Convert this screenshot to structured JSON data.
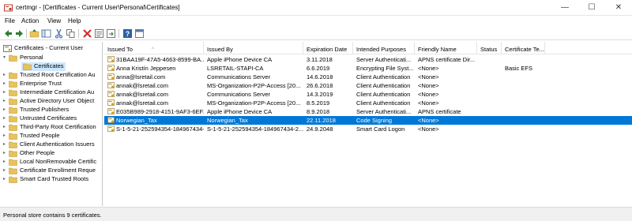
{
  "window": {
    "title": "certmgr - [Certificates - Current User\\Personal\\Certificates]",
    "minimize_glyph": "—",
    "maximize_glyph": "☐",
    "close_glyph": "✕"
  },
  "menu": [
    "File",
    "Action",
    "View",
    "Help"
  ],
  "toolbar": {
    "icons": [
      "back-icon",
      "forward-icon",
      "up-folder-icon",
      "show-hide-tree-icon",
      "cut-icon",
      "copy-icon",
      "delete-icon",
      "properties-icon",
      "export-icon",
      "help-icon",
      "console-icon"
    ]
  },
  "tree": {
    "root": "Certificates - Current User",
    "personal": "Personal",
    "certificates": "Certificates",
    "stores": [
      "Trusted Root Certification Au",
      "Enterprise Trust",
      "Intermediate Certification Au",
      "Active Directory User Object",
      "Trusted Publishers",
      "Untrusted Certificates",
      "Third-Party Root Certification",
      "Trusted People",
      "Client Authentication Issuers",
      "Other People",
      "Local NonRemovable Certific",
      "Certificate Enrollment Reque",
      "Smart Card Trusted Roots"
    ]
  },
  "columns": [
    "Issued To",
    "Issued By",
    "Expiration Date",
    "Intended Purposes",
    "Friendly Name",
    "Status",
    "Certificate Te..."
  ],
  "rows": [
    {
      "issued_to": "31BAA19F-47A5-4663-8599-BA...",
      "issued_by": "Apple iPhone Device CA",
      "expiration": "3.11.2018",
      "purposes": "Server Authenticati...",
      "friendly": "APNS certificate Dir...",
      "status": "",
      "template": ""
    },
    {
      "issued_to": "Anna Kristín Jeppesen",
      "issued_by": "LSRETAIL-STAPI-CA",
      "expiration": "6.6.2019",
      "purposes": "Encrypting File Syst...",
      "friendly": "<None>",
      "status": "",
      "template": "Basic EFS"
    },
    {
      "issued_to": "anna@lsretail.com",
      "issued_by": "Communications Server",
      "expiration": "14.6.2018",
      "purposes": "Client Authentication",
      "friendly": "<None>",
      "status": "",
      "template": ""
    },
    {
      "issued_to": "annak@lsretail.com",
      "issued_by": "MS-Organization-P2P-Access [20...",
      "expiration": "26.6.2018",
      "purposes": "Client Authentication",
      "friendly": "<None>",
      "status": "",
      "template": ""
    },
    {
      "issued_to": "annak@lsretail.com",
      "issued_by": "Communications Server",
      "expiration": "14.3.2019",
      "purposes": "Client Authentication",
      "friendly": "<None>",
      "status": "",
      "template": ""
    },
    {
      "issued_to": "annak@lsretail.com",
      "issued_by": "MS-Organization-P2P-Access [20...",
      "expiration": "8.5.2019",
      "purposes": "Client Authentication",
      "friendly": "<None>",
      "status": "",
      "template": ""
    },
    {
      "issued_to": "E035B989-2918-4151-9AF3-6EF2...",
      "issued_by": "Apple iPhone Device CA",
      "expiration": "8.9.2018",
      "purposes": "Server Authenticati...",
      "friendly": "APNS certificate",
      "status": "",
      "template": ""
    },
    {
      "issued_to": "Norwegian_Tax",
      "issued_by": "Norwegian_Tax",
      "expiration": "22.11.2018",
      "purposes": "Code Signing",
      "friendly": "<None>",
      "status": "",
      "template": "",
      "selected": true
    },
    {
      "issued_to": "S-1-5-21-252594354-184967434-2...",
      "issued_by": "S-1-5-21-252594354-184967434-2...",
      "expiration": "24.9.2048",
      "purposes": "Smart Card Logon",
      "friendly": "<None>",
      "status": "",
      "template": ""
    }
  ],
  "status": "Personal store contains 9 certificates.",
  "colors": {
    "selection": "#0078d7",
    "folder": "#e8c25a"
  }
}
